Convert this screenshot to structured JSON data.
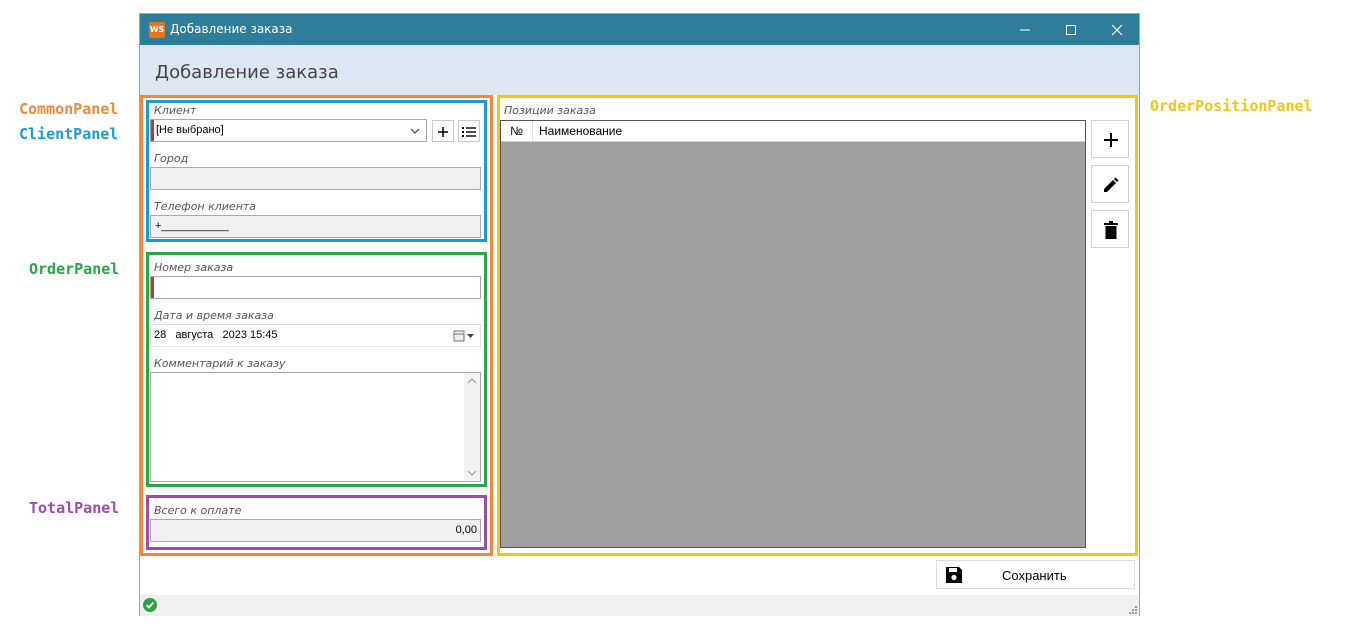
{
  "annotations": {
    "common_panel": "CommonPanel",
    "client_panel": "ClientPanel",
    "order_panel": "OrderPanel",
    "total_panel": "TotalPanel",
    "order_position_panel": "OrderPositionPanel"
  },
  "colors": {
    "common": "#f0893a",
    "client": "#1a9bd7",
    "order": "#27a844",
    "total": "#9b4ea8",
    "positions": "#f5c518",
    "titlebar": "#2e7d9a"
  },
  "window": {
    "icon_text": "WS",
    "title": "Добавление заказа",
    "header_title": "Добавление заказа"
  },
  "client": {
    "label": "Клиент",
    "value": "[Не выбрано]",
    "city_label": "Город",
    "city_value": "",
    "phone_label": "Телефон клиента",
    "phone_value": "+___________"
  },
  "order": {
    "number_label": "Номер заказа",
    "number_value": "",
    "date_label": "Дата и время заказа",
    "date_value": "28   августа   2023 15:45",
    "comment_label": "Комментарий к заказу",
    "comment_value": ""
  },
  "total": {
    "label": "Всего к оплате",
    "value": "0,00"
  },
  "positions": {
    "label": "Позиции заказа",
    "col_num": "№",
    "col_name": "Наименование"
  },
  "footer": {
    "save_label": "Сохранить"
  }
}
